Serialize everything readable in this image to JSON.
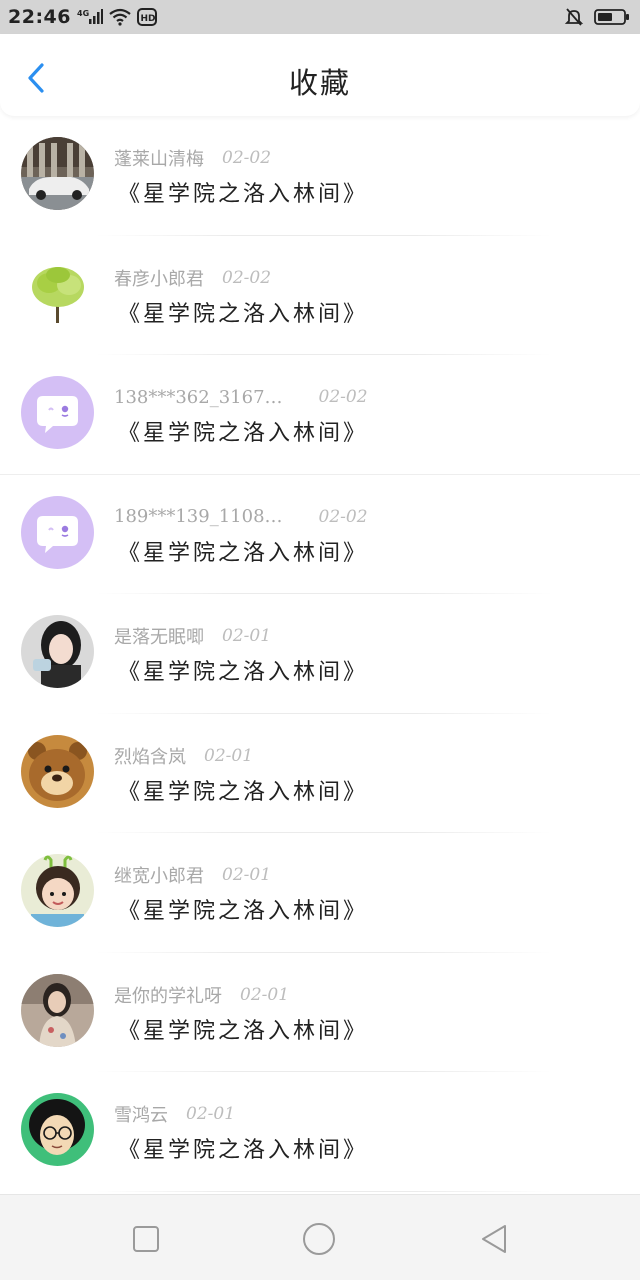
{
  "status_bar": {
    "time": "22:46",
    "signal_label": "4G",
    "hd_label": "HD",
    "icons": [
      "signal-icon",
      "wifi-icon",
      "hd-icon",
      "muted-bell-icon",
      "battery-icon"
    ]
  },
  "header": {
    "title": "收藏",
    "back_icon": "chevron-left-icon",
    "accent_color": "#2b8ff0"
  },
  "items": [
    {
      "name": "蓬莱山清梅",
      "date": "02-02",
      "title": "《星学院之洛入林间》",
      "avatar": "car-photo"
    },
    {
      "name": "春彦小郎君",
      "date": "02-02",
      "title": "《星学院之洛入林间》",
      "avatar": "tree-photo"
    },
    {
      "name": "138***362_3167…",
      "date": "02-02",
      "title": "《星学院之洛入林间》",
      "avatar": "default-chat-avatar"
    },
    {
      "name": "189***139_1108…",
      "date": "02-02",
      "title": "《星学院之洛入林间》",
      "avatar": "default-chat-avatar"
    },
    {
      "name": "是落无眠唧",
      "date": "02-01",
      "title": "《星学院之洛入林间》",
      "avatar": "girl-photo"
    },
    {
      "name": "烈焰含岚",
      "date": "02-01",
      "title": "《星学院之洛入林间》",
      "avatar": "bear-cartoon"
    },
    {
      "name": "继宽小郎君",
      "date": "02-01",
      "title": "《星学院之洛入林间》",
      "avatar": "child-photo"
    },
    {
      "name": "是你的学礼呀",
      "date": "02-01",
      "title": "《星学院之洛入林间》",
      "avatar": "woman-photo"
    },
    {
      "name": "雪鸿云",
      "date": "02-01",
      "title": "《星学院之洛入林间》",
      "avatar": "glasses-cartoon"
    }
  ],
  "nav_bar": {
    "icons": [
      "recents-square-icon",
      "home-circle-icon",
      "back-triangle-icon"
    ]
  }
}
